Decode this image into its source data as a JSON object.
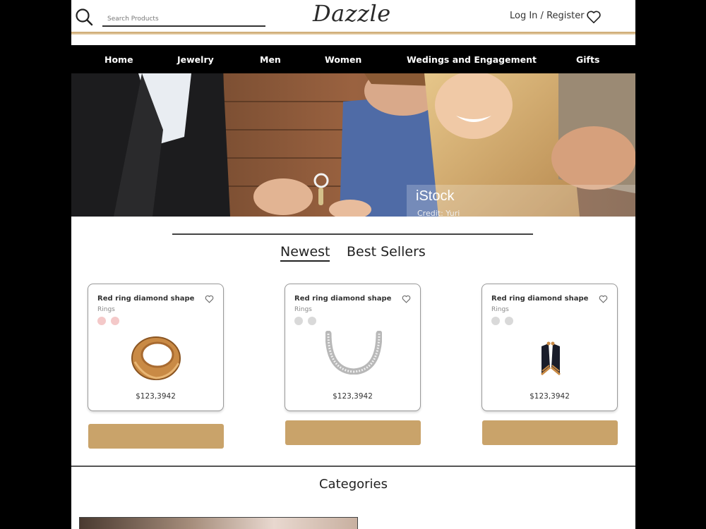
{
  "header": {
    "logo": "Dazzle",
    "search_placeholder": "Search Products",
    "login_label": "Log In / Register"
  },
  "nav": {
    "items": [
      "Home",
      "Jewelry",
      "Men",
      "Women",
      "Wedings and Engagement",
      "Gifts"
    ]
  },
  "hero": {
    "credit": "iStock",
    "credit_sub": "Credit: Yuri"
  },
  "tabs": {
    "newest": "Newest",
    "best_sellers": "Best Sellers"
  },
  "products": [
    {
      "title": "Red ring diamond shape",
      "category": "Rings",
      "price": "$123,3942",
      "swatch_colors": [
        "#f4c9c9",
        "#f4c9c9"
      ],
      "image": "gold-ring"
    },
    {
      "title": "Red ring diamond shape",
      "category": "Rings",
      "price": "$123,3942",
      "swatch_colors": [
        "#d9d9d9",
        "#d9d9d9"
      ],
      "image": "diamond-necklace"
    },
    {
      "title": "Red ring diamond shape",
      "category": "Rings",
      "price": "$123,3942",
      "swatch_colors": [
        "#d9d9d9",
        "#d9d9d9"
      ],
      "image": "gold-earrings"
    }
  ],
  "sections": {
    "categories": "Categories"
  },
  "colors": {
    "accent_gold": "#c9a36a",
    "nav_bg": "#000000",
    "text_dark": "#222222"
  }
}
